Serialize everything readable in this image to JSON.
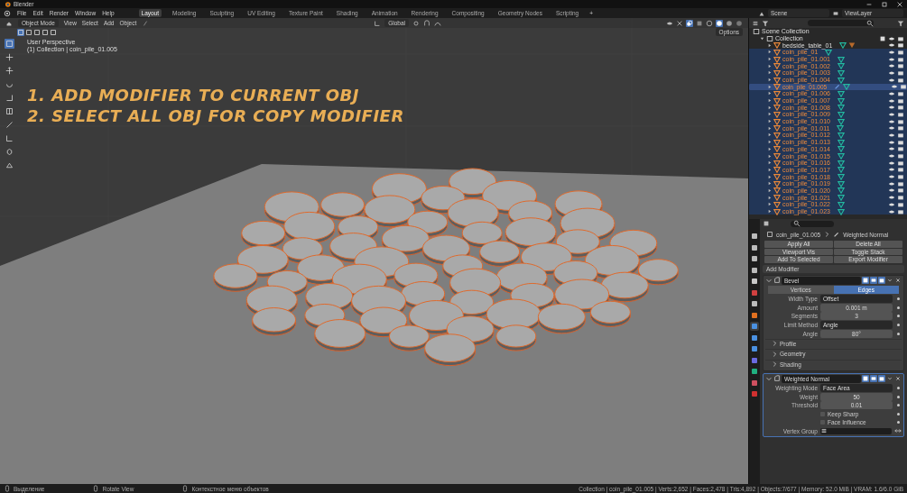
{
  "window": {
    "title": "Blender"
  },
  "menu": [
    "File",
    "Edit",
    "Render",
    "Window",
    "Help"
  ],
  "workspaces": [
    {
      "label": "Layout",
      "selected": true
    },
    {
      "label": "Modeling",
      "selected": false
    },
    {
      "label": "Sculpting",
      "selected": false
    },
    {
      "label": "UV Editing",
      "selected": false
    },
    {
      "label": "Texture Paint",
      "selected": false
    },
    {
      "label": "Shading",
      "selected": false
    },
    {
      "label": "Animation",
      "selected": false
    },
    {
      "label": "Rendering",
      "selected": false
    },
    {
      "label": "Compositing",
      "selected": false
    },
    {
      "label": "Geometry Nodes",
      "selected": false
    },
    {
      "label": "Scripting",
      "selected": false
    }
  ],
  "add_workspace": "+",
  "scene": "Scene",
  "view_layer": "ViewLayer",
  "viewport": {
    "mode": "Object Mode",
    "menus": [
      "View",
      "Select",
      "Add",
      "Object"
    ],
    "orientation": "Global",
    "options": "Options",
    "view_name": "User Perspective",
    "context": "(1) Collection | coin_pile_01.005",
    "annotations": [
      "1. ADD MODIFIER TO CURRENT OBJ",
      "2. SELECT ALL OBJ FOR COPY MODIFIER"
    ]
  },
  "outliner": {
    "tree": [
      {
        "name": "Scene Collection",
        "kind": "scene_collection",
        "children": [
          {
            "name": "Collection",
            "kind": "collection",
            "expanded": true,
            "children": [
              {
                "name": "bedside_table_01",
                "kind": "object",
                "selected": false,
                "active": false,
                "expanded": false,
                "modifier": false,
                "material": true
              },
              {
                "name": "coin_pile_01",
                "kind": "object",
                "selected": true,
                "active": false,
                "expanded": false,
                "modifier": false,
                "material": false
              },
              {
                "name": "coin_pile_01.001",
                "kind": "object",
                "selected": true,
                "active": false,
                "expanded": false,
                "modifier": false,
                "material": false
              },
              {
                "name": "coin_pile_01.002",
                "kind": "object",
                "selected": true,
                "active": false,
                "expanded": false,
                "modifier": false,
                "material": false
              },
              {
                "name": "coin_pile_01.003",
                "kind": "object",
                "selected": true,
                "active": false,
                "expanded": false,
                "modifier": false,
                "material": false
              },
              {
                "name": "coin_pile_01.004",
                "kind": "object",
                "selected": true,
                "active": false,
                "expanded": false,
                "modifier": false,
                "material": false
              },
              {
                "name": "coin_pile_01.005",
                "kind": "object",
                "selected": true,
                "active": true,
                "expanded": false,
                "modifier": true,
                "material": false
              },
              {
                "name": "coin_pile_01.006",
                "kind": "object",
                "selected": true,
                "active": false,
                "expanded": false,
                "modifier": false,
                "material": false
              },
              {
                "name": "coin_pile_01.007",
                "kind": "object",
                "selected": true,
                "active": false,
                "expanded": false,
                "modifier": false,
                "material": false
              },
              {
                "name": "coin_pile_01.008",
                "kind": "object",
                "selected": true,
                "active": false,
                "expanded": false,
                "modifier": false,
                "material": false
              },
              {
                "name": "coin_pile_01.009",
                "kind": "object",
                "selected": true,
                "active": false,
                "expanded": false,
                "modifier": false,
                "material": false
              },
              {
                "name": "coin_pile_01.010",
                "kind": "object",
                "selected": true,
                "active": false,
                "expanded": false,
                "modifier": false,
                "material": false
              },
              {
                "name": "coin_pile_01.011",
                "kind": "object",
                "selected": true,
                "active": false,
                "expanded": false,
                "modifier": false,
                "material": false
              },
              {
                "name": "coin_pile_01.012",
                "kind": "object",
                "selected": true,
                "active": false,
                "expanded": false,
                "modifier": false,
                "material": false
              },
              {
                "name": "coin_pile_01.013",
                "kind": "object",
                "selected": true,
                "active": false,
                "expanded": false,
                "modifier": false,
                "material": false
              },
              {
                "name": "coin_pile_01.014",
                "kind": "object",
                "selected": true,
                "active": false,
                "expanded": false,
                "modifier": false,
                "material": false
              },
              {
                "name": "coin_pile_01.015",
                "kind": "object",
                "selected": true,
                "active": false,
                "expanded": false,
                "modifier": false,
                "material": false
              },
              {
                "name": "coin_pile_01.016",
                "kind": "object",
                "selected": true,
                "active": false,
                "expanded": false,
                "modifier": false,
                "material": false
              },
              {
                "name": "coin_pile_01.017",
                "kind": "object",
                "selected": true,
                "active": false,
                "expanded": false,
                "modifier": false,
                "material": false
              },
              {
                "name": "coin_pile_01.018",
                "kind": "object",
                "selected": true,
                "active": false,
                "expanded": false,
                "modifier": false,
                "material": false
              },
              {
                "name": "coin_pile_01.019",
                "kind": "object",
                "selected": true,
                "active": false,
                "expanded": false,
                "modifier": false,
                "material": false
              },
              {
                "name": "coin_pile_01.020",
                "kind": "object",
                "selected": true,
                "active": false,
                "expanded": false,
                "modifier": false,
                "material": false
              },
              {
                "name": "coin_pile_01.021",
                "kind": "object",
                "selected": true,
                "active": false,
                "expanded": false,
                "modifier": false,
                "material": false
              },
              {
                "name": "coin_pile_01.022",
                "kind": "object",
                "selected": true,
                "active": false,
                "expanded": false,
                "modifier": false,
                "material": false
              },
              {
                "name": "coin_pile_01.023",
                "kind": "object",
                "selected": true,
                "active": false,
                "expanded": false,
                "modifier": false,
                "material": false
              }
            ]
          }
        ]
      }
    ]
  },
  "properties": {
    "tabs": [
      {
        "selected": false
      },
      {
        "selected": false
      },
      {
        "selected": false
      },
      {
        "selected": false
      },
      {
        "selected": false
      },
      {
        "selected": false
      },
      {
        "selected": false
      },
      {
        "selected": false
      },
      {
        "selected": true
      },
      {
        "selected": false
      },
      {
        "selected": false
      },
      {
        "selected": false
      },
      {
        "selected": false
      },
      {
        "selected": false
      },
      {
        "selected": false
      }
    ],
    "object": "coin_pile_01.005",
    "modifier": "Weighted Normal",
    "actions": [
      "Apply All",
      "Delete All",
      "Viewport Vis",
      "Toggle Stack",
      "Add To Selected",
      "Export Modifier"
    ],
    "add_modifier": "Add Modifier",
    "modifiers": [
      {
        "name": "Bevel",
        "expanded": true,
        "segments": [
          {
            "label": "Vertices",
            "selected": false
          },
          {
            "label": "Edges",
            "selected": true
          }
        ],
        "fields": [
          {
            "kind": "dropdown",
            "label": "Width Type",
            "value": "Offset"
          },
          {
            "kind": "number",
            "label": "Amount",
            "value": "0.001 m"
          },
          {
            "kind": "number",
            "label": "Segments",
            "value": "3"
          },
          {
            "kind": "dropdown",
            "label": "Limit Method",
            "value": "Angle"
          },
          {
            "kind": "number",
            "label": "Angle",
            "value": "80°"
          }
        ],
        "subpanels": [
          {
            "label": "Profile",
            "expanded": false
          },
          {
            "label": "Geometry",
            "expanded": false
          },
          {
            "label": "Shading",
            "expanded": false
          }
        ]
      },
      {
        "name": "Weighted Normal",
        "expanded": true,
        "fields": [
          {
            "kind": "dropdown",
            "label": "Weighting Mode",
            "value": "Face Area"
          },
          {
            "kind": "number",
            "label": "Weight",
            "value": "50"
          },
          {
            "kind": "number",
            "label": "Threshold",
            "value": "0.01"
          },
          {
            "kind": "checkbox",
            "label": "Keep Sharp",
            "checked": false
          },
          {
            "kind": "checkbox",
            "label": "Face Influence",
            "checked": false
          },
          {
            "kind": "vertex_group",
            "label": "Vertex Group"
          }
        ]
      }
    ]
  },
  "status": {
    "hints": [
      "Выделение",
      "Rotate View",
      "Контекстное меню объектов"
    ],
    "info": "Collection | coin_pile_01.005 | Verts:2,652 | Faces:2,478 | Tris:4,892 | Objects:7/677 | Memory: 52.0 MiB | VRAM: 1.6/6.0 GiB"
  }
}
